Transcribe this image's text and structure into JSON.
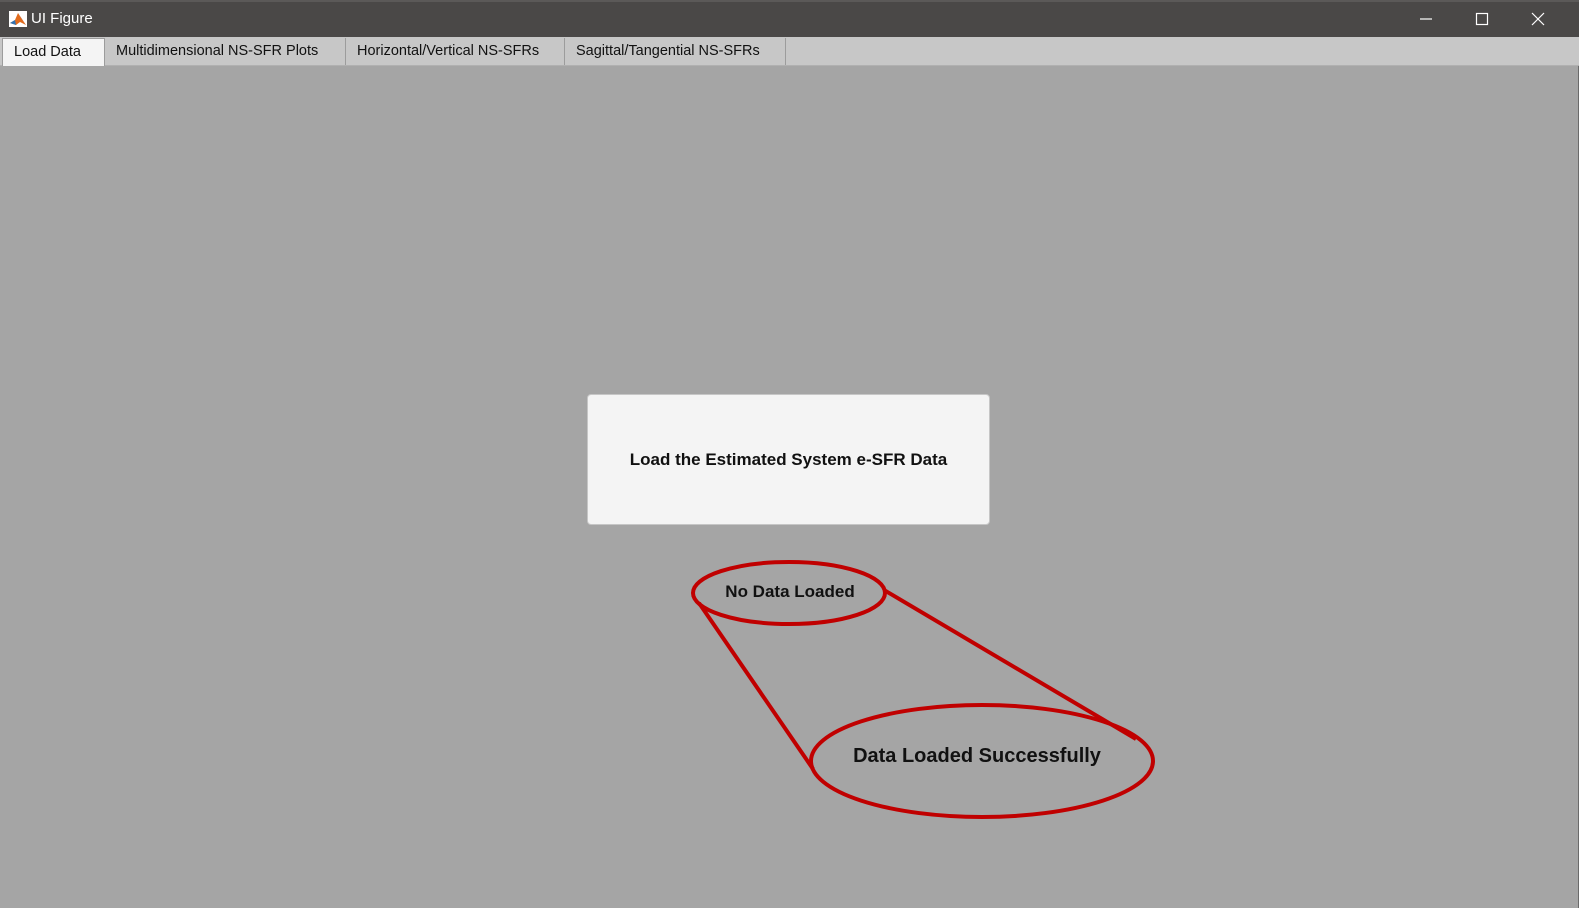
{
  "window": {
    "title": "UI Figure",
    "icon": "matlab-icon",
    "controls": [
      "minimize-icon",
      "maximize-icon",
      "close-icon"
    ]
  },
  "tabs": [
    {
      "label": "Load Data",
      "active": true
    },
    {
      "label": "Multidimensional NS-SFR Plots",
      "active": false
    },
    {
      "label": "Horizontal/Vertical NS-SFRs",
      "active": false
    },
    {
      "label": "Sagittal/Tangential NS-SFRs",
      "active": false
    }
  ],
  "main": {
    "load_button_label": "Load the Estimated System e-SFR Data",
    "status_label": "No Data Loaded"
  },
  "annotation": {
    "callout_text": "Data Loaded Successfully",
    "color": "#c00000"
  },
  "colors": {
    "titlebar": "#4a4847",
    "tabbar": "#c7c7c7",
    "content_bg": "#a5a5a5",
    "button_bg": "#f4f4f4"
  }
}
